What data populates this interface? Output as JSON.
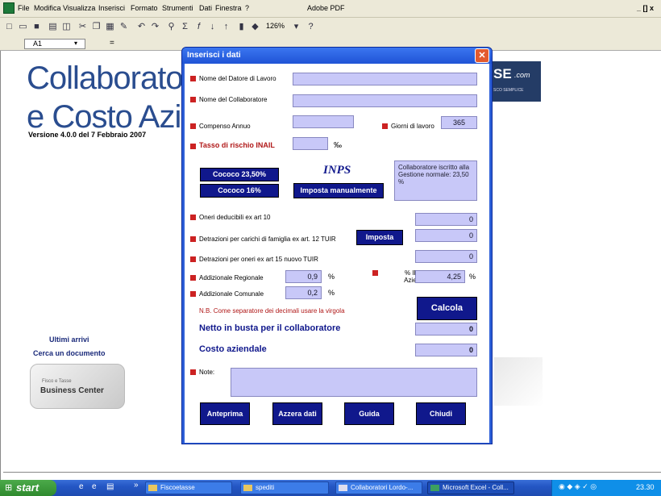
{
  "menubar": {
    "items": [
      "File",
      "Modifica",
      "Visualizza",
      "Inserisci",
      "Formato",
      "Strumenti",
      "Dati",
      "Finestra",
      "?",
      "Adobe PDF"
    ],
    "window_controls": "_ [] x"
  },
  "toolbar": {
    "zoom": "126%"
  },
  "formulabar": {
    "cell_ref": "A1",
    "eq": "="
  },
  "sheet": {
    "title_line1": "Collaboratori Lo",
    "title_line2": "e Costo Aziend",
    "version": "Versione 4.0.0 del 7 Febbraio 2007",
    "logo_right": "SE",
    "logo_com": ".com",
    "logo_tagline": "SCO SEMPLICE",
    "link_ultimi": "Ultimi arrivi",
    "link_cerca": "Cerca un documento",
    "bc_small": "Fisco e Tasse",
    "bc_big": "Business Center"
  },
  "dialog": {
    "title": "Inserisci i dati",
    "close": "✕",
    "labels": {
      "datore": "Nome del Datore di Lavoro",
      "collaboratore": "Nome del Collaboratore",
      "compenso": "Compenso Annuo",
      "giorni": "Giorni di lavoro",
      "inail": "Tasso di rischio INAIL",
      "permille": "‰",
      "inps": "INPS",
      "oneri": "Oneri deducibili ex art 10",
      "detr_fam": "Detrazioni per carichi di famiglia ex art. 12 TUIR",
      "detr_oneri": "Detrazioni per oneri ex art 15 nuovo TUIR",
      "add_reg": "Addizionale Regionale",
      "add_com": "Addizionale Comunale",
      "pct": "%",
      "irap": "% IRAP Azienda",
      "nb": "N.B. Come separatore dei decimali usare la virgola",
      "netto": "Netto in busta per il collaboratore",
      "costo": "Costo aziendale",
      "note": "Note:"
    },
    "values": {
      "datore": "",
      "collaboratore": "",
      "compenso": "",
      "giorni": "365",
      "inail": "",
      "oneri": "0",
      "detr_fam": "0",
      "detr_oneri": "0",
      "add_reg": "0,9",
      "add_com": "0,2",
      "irap": "4,25",
      "netto": "0",
      "costo": "0",
      "note": ""
    },
    "inps_info": "Collaboratore iscritto alla Gestione normale: 23,50 %",
    "buttons": {
      "cococo1": "Cococo 23,50%",
      "cococo2": "Cococo 16%",
      "manual": "Imposta manualmente",
      "imposta": "Imposta",
      "calcola": "Calcola",
      "anteprima": "Anteprima",
      "azzera": "Azzera dati",
      "guida": "Guida",
      "chiudi": "Chiudi"
    }
  },
  "taskbar": {
    "start": "start",
    "items": [
      "Fiscoetasse",
      "spediti",
      "Collaboratori Lordo-...",
      "Microsoft Excel - Coll..."
    ],
    "clock": "23.30"
  }
}
